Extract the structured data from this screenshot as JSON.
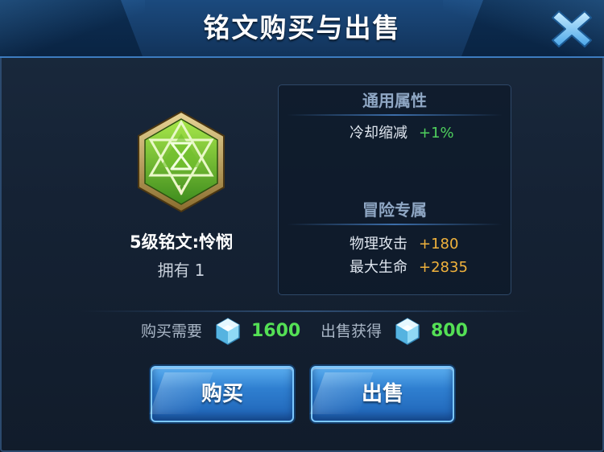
{
  "dialog": {
    "title": "铭文购买与出售",
    "close_icon": "close-x-icon"
  },
  "rune": {
    "icon": "green-hexagon-star-rune-icon",
    "level_numeral": "V",
    "name": "5级铭文:怜悯",
    "owned_label": "拥有",
    "owned_count": "1"
  },
  "attributes": {
    "general_header": "通用属性",
    "general": [
      {
        "label": "冷却缩减",
        "value": "+1%",
        "color": "#4fd15d"
      }
    ],
    "adventure_header": "冒险专属",
    "adventure": [
      {
        "label": "物理攻击",
        "value": "+180",
        "color": "#f0b23c"
      },
      {
        "label": "最大生命",
        "value": "+2835",
        "color": "#f0b23c"
      }
    ]
  },
  "price": {
    "buy_label": "购买需要",
    "buy_amount": "1600",
    "sell_label": "出售获得",
    "sell_amount": "800",
    "currency_icon": "crystal-gem-icon",
    "amount_color": "#54e055"
  },
  "buttons": {
    "buy_label": "购买",
    "sell_label": "出售"
  }
}
